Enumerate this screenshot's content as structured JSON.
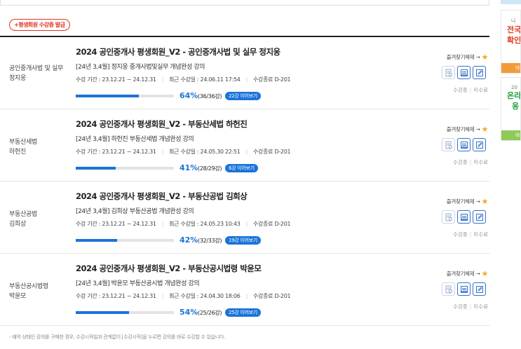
{
  "cert_button": "+평생회원 수강증 발급",
  "labels": {
    "fav": "즐겨찾기해제 →",
    "status_active": "수강중",
    "status_done": "미수료"
  },
  "courses": [
    {
      "subject": [
        "공인중개사법 및 실무",
        "정지웅"
      ],
      "title": "2024 공인중개사 평생회원_V2 - 공인중개사법 및 실무 정지웅",
      "sub": "[24년 3,4월] 정지웅 중개사법및실무 개념완성 강의",
      "period": "수강 기간 : 23.12.21 ~ 24.12.31",
      "recent": "최근 수강일 : 24.06.11 17:54",
      "end": "수강종료 D-201",
      "progress": 64,
      "percent_text": "64%",
      "count_text": "(36/36강)",
      "resume": "22강 이어보기"
    },
    {
      "subject": [
        "부동산세법",
        "하헌진"
      ],
      "title": "2024 공인중개사 평생회원_V2 - 부동산세법 하헌진",
      "sub": "[24년 3,4월] 하헌진 부동산세법 개념완성 강의",
      "period": "수강 기간 : 23.12.21 ~ 24.12.31",
      "recent": "최근 수강일 : 24.05.30 22:51",
      "end": "수강종료 D-201",
      "progress": 41,
      "percent_text": "41%",
      "count_text": "(28/29강)",
      "resume": "6강 이어보기"
    },
    {
      "subject": [
        "부동산공법",
        "김희상"
      ],
      "title": "2024 공인중개사 평생회원_V2 - 부동산공법 김희상",
      "sub": "[24년 3,4월] 김희상 부동산공법 개념완성 강의",
      "period": "수강 기간 : 23.12.21 ~ 24.12.31",
      "recent": "최근 수강일 : 24.05.23 10:43",
      "end": "수강종료 D-201",
      "progress": 42,
      "percent_text": "42%",
      "count_text": "(32/33강)",
      "resume": "19강 이어보기"
    },
    {
      "subject": [
        "부동산공시법령",
        "박윤모"
      ],
      "title": "2024 공인중개사 평생회원_V2 - 부동산공시법령 박윤모",
      "sub": "[24년 3,4월] 박윤모 부동산공시법 개념완성 강의",
      "period": "수강 기간 : 23.12.21 ~ 24.12.31",
      "recent": "최근 수강일 : 24.04.30 18:06",
      "end": "수강종료 D-201",
      "progress": 54,
      "percent_text": "54%",
      "count_text": "(25/26강)",
      "resume": "25강 이어보기"
    }
  ],
  "notice": "- 예약 상태인 강의를 구매한 경우, 수강시작일과 관계없이 [수강시작]을 누르면 강의를 바로 수강할 수 있습니다.",
  "side_banners": [
    {
      "line1": "나",
      "line2a": "전국",
      "line2b": "확인",
      "foot": "바"
    },
    {
      "line1": "20",
      "line2a": "온라",
      "line2b": "응",
      "foot": "바"
    }
  ],
  "colors": {
    "accent": "#1a73d9",
    "cert": "#e0341f",
    "star": "#f5a623"
  }
}
